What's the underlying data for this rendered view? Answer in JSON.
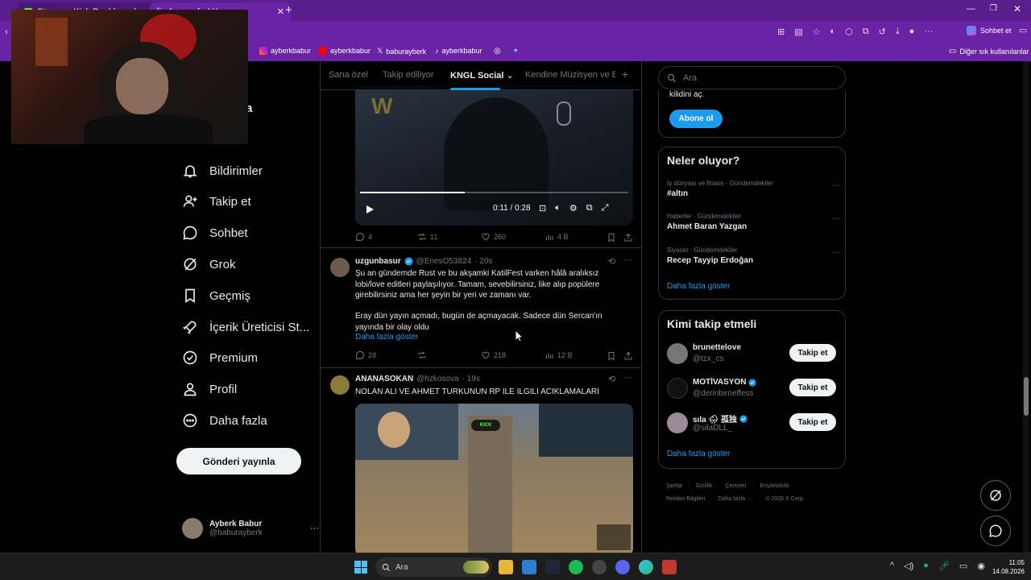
{
  "browser": {
    "tabs": [
      {
        "label": "Stream - Kick Dashboard"
      },
      {
        "label": "Anasayfa / X"
      }
    ],
    "new_tab": "+",
    "toolbar_chat": "Sohbet et",
    "bookmarks": [
      {
        "label": "ayberkbabur",
        "icon": "instagram-icon"
      },
      {
        "label": "ayberkbabur",
        "icon": "youtube-icon"
      },
      {
        "label": "baburayberk",
        "icon": "x-icon"
      },
      {
        "label": "ayberkbabur",
        "icon": "tiktok-icon"
      }
    ],
    "other_bookmarks": "Diğer sık kullanılanlar"
  },
  "nav": {
    "home_partial": "fa",
    "items": [
      {
        "label": "Bildirimler",
        "icon": "bell-icon"
      },
      {
        "label": "Takip et",
        "icon": "add-user-icon"
      },
      {
        "label": "Sohbet",
        "icon": "chat-icon"
      },
      {
        "label": "Grok",
        "icon": "grok-icon"
      },
      {
        "label": "Geçmiş",
        "icon": "bookmark-icon"
      },
      {
        "label": "İçerik Üreticisi St...",
        "icon": "rocket-icon"
      },
      {
        "label": "Premium",
        "icon": "verified-icon"
      },
      {
        "label": "Profil",
        "icon": "user-icon"
      },
      {
        "label": "Daha fazla",
        "icon": "more-circle-icon"
      }
    ],
    "post_button": "Gönderi yayınla",
    "account": {
      "name": "Ayberk Babur",
      "handle": "@baburayberk",
      "more": "···"
    }
  },
  "feed": {
    "tabs": [
      "Sana özel",
      "Takip ediliyor",
      "KNGL Social",
      "Kendine Müzisyen ve Ba"
    ],
    "active_tab": "KNGL Social",
    "add_tab": "+",
    "video_post": {
      "time": "0:11 / 0:28",
      "progress": 0.39,
      "stats": {
        "replies": "4",
        "reposts": "11",
        "likes": "260",
        "views": "4 B"
      }
    },
    "post1": {
      "name": "uzgunbasur",
      "handle": "@EnesO53824",
      "time": "· 20s",
      "text1": "Şu an gündemde Rust ve bu akşamki KatilFest varken hâlâ aralıksız lobi/love editleri paylaşılıyor. Tamam, sevebilirsiniz, like alıp popülere girebilirsiniz ama her şeyin bir yeri ve zamanı var.",
      "text2": "Eray dün yayın açmadı, bugün de açmayacak. Sadece dün Sercan'ın yayında bir olay oldu",
      "show_more": "Daha fazla göster",
      "stats": {
        "replies": "28",
        "reposts": "",
        "likes": "218",
        "views": "12 B"
      }
    },
    "post2": {
      "name": "ANANASOKAN",
      "handle": "@hzkosova",
      "time": "· 19s",
      "text": "NOLAN ALI VE AHMET TURKUNUN RP ILE ILGILI ACIKLAMALARI"
    }
  },
  "right": {
    "search_placeholder": "Ara",
    "premium": {
      "text": "kilidini aç.",
      "button": "Abone ol"
    },
    "trends": {
      "title": "Neler oluyor?",
      "items": [
        {
          "category": "İş dünyası ve finans · Gündemdekiler",
          "name": "#altın"
        },
        {
          "category": "Haberler · Gündemdekiler",
          "name": "Ahmet Baran Yazgan"
        },
        {
          "category": "Siyaset · Gündemdekiler",
          "name": "Recep Tayyip Erdoğan"
        }
      ],
      "show_more": "Daha fazla göster"
    },
    "who_to_follow": {
      "title": "Kimi takip etmeli",
      "users": [
        {
          "name": "brunettelove",
          "handle": "@tzx_cs",
          "verified": false
        },
        {
          "name": "MOTİVASYON",
          "handle": "@derinbirneffess",
          "verified": true
        },
        {
          "name": "sıla 🌧 孤独",
          "handle": "@silaDLL_",
          "verified": true
        }
      ],
      "follow_label": "Takip et",
      "show_more": "Daha fazla göster"
    },
    "footer": {
      "line1": [
        "Şartlar",
        "Gizlilik",
        "Çerezler",
        "Erişilebilirlik"
      ],
      "line2": [
        "Reklam Bilgileri",
        "Daha fazla ···",
        "© 2026 X Corp."
      ]
    }
  },
  "taskbar": {
    "search": "Ara",
    "time": "11:05",
    "date": "14.08.2026"
  },
  "colors": {
    "accent": "#1d9bf0",
    "browser": "#6a23a5",
    "tabbar": "#5a1e8c"
  }
}
